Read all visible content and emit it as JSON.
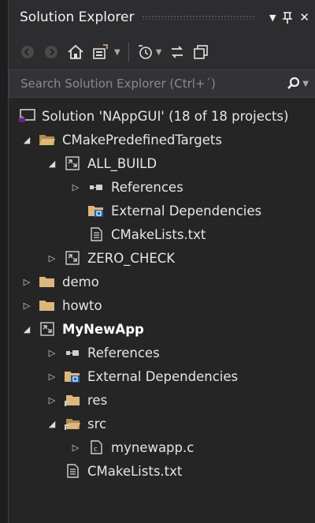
{
  "header": {
    "title": "Solution Explorer",
    "dropdown_icon": "▼",
    "pin_icon": "ᴨ",
    "close_icon": "✕"
  },
  "toolbar": {
    "back_icon": "◀",
    "forward_icon": "▶",
    "home_icon": "⌂",
    "sync_icon": "▣",
    "history_icon": "↺",
    "collapse_icon": "⇆",
    "properties_icon": "❐"
  },
  "search": {
    "placeholder": "Search Solution Explorer (Ctrl+´)",
    "search_icon": "⚲"
  },
  "tree": {
    "solution": "Solution 'NAppGUI' (18 of 18 projects)",
    "cmake_targets": "CMakePredefinedTargets",
    "all_build": "ALL_BUILD",
    "references_1": "References",
    "external_deps_1": "External Dependencies",
    "cmakelists_1": "CMakeLists.txt",
    "zero_check": "ZERO_CHECK",
    "demo": "demo",
    "howto": "howto",
    "mynewapp": "MyNewApp",
    "references_2": "References",
    "external_deps_2": "External Dependencies",
    "res": "res",
    "src": "src",
    "mynewapp_c": "mynewapp.c",
    "cmakelists_2": "CMakeLists.txt"
  },
  "colors": {
    "folder": "#dcb67a",
    "vs_purple": "#68217a",
    "panel_bg": "#252526"
  }
}
